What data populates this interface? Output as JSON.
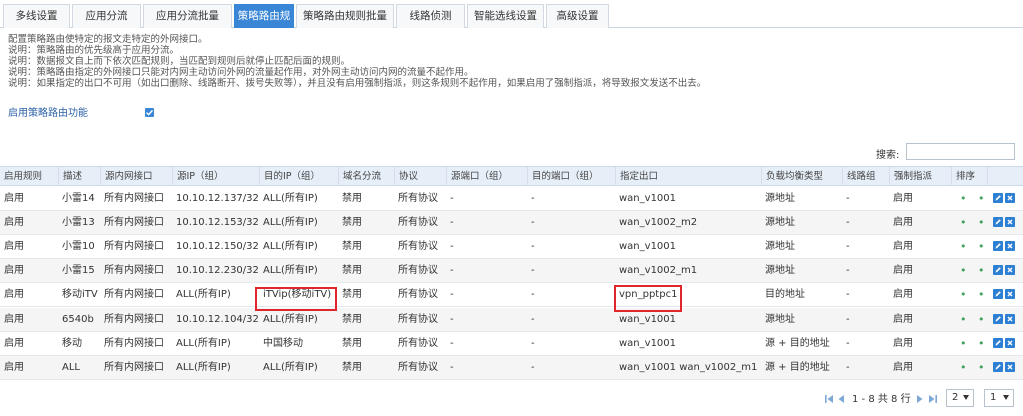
{
  "tabs": [
    {
      "label": "多线设置",
      "active": false
    },
    {
      "label": "应用分流",
      "active": false
    },
    {
      "label": "应用分流批量",
      "active": false
    },
    {
      "label": "策略路由规则",
      "active": true
    },
    {
      "label": "策略路由规则批量",
      "active": false
    },
    {
      "label": "线路侦测",
      "active": false
    },
    {
      "label": "智能选线设置",
      "active": false
    },
    {
      "label": "高级设置",
      "active": false
    }
  ],
  "description": [
    "配置策略路由使特定的报文走特定的外网接口。",
    "说明：策略路由的优先级高于应用分流。",
    "说明：数据报文自上而下依次匹配规则，当匹配到规则后就停止匹配后面的规则。",
    "说明：策略路由指定的外网接口只能对内网主动访问外网的流量起作用，对外网主动访问内网的流量不起作用。",
    "说明：如果指定的出口不可用（如出口删除、线路断开、拨号失败等），并且没有启用强制指派，则这条规则不起作用，如果启用了强制指派，将导致报文发送不出去。"
  ],
  "enable": {
    "label": "启用策略路由功能",
    "checked": true
  },
  "search": {
    "label": "搜索:",
    "value": ""
  },
  "columns": [
    "启用规则",
    "描述",
    "源内网接口",
    "源IP（组）",
    "目的IP（组）",
    "域名分流",
    "协议",
    "源端口（组）",
    "目的端口（组）",
    "指定出口",
    "负载均衡类型",
    "线路组",
    "强制指派",
    "排序"
  ],
  "rows": [
    [
      "启用",
      "小雷14",
      "所有内网接口",
      "10.10.12.137/32",
      "ALL(所有IP)",
      "禁用",
      "所有协议",
      "-",
      "-",
      "wan_v1001",
      "源地址",
      "-",
      "启用"
    ],
    [
      "启用",
      "小雷13",
      "所有内网接口",
      "10.10.12.153/32",
      "ALL(所有IP)",
      "禁用",
      "所有协议",
      "-",
      "-",
      "wan_v1002_m2",
      "源地址",
      "-",
      "启用"
    ],
    [
      "启用",
      "小雷10",
      "所有内网接口",
      "10.10.12.150/32",
      "ALL(所有IP)",
      "禁用",
      "所有协议",
      "-",
      "-",
      "wan_v1001",
      "源地址",
      "-",
      "启用"
    ],
    [
      "启用",
      "小雷15",
      "所有内网接口",
      "10.10.12.230/32",
      "ALL(所有IP)",
      "禁用",
      "所有协议",
      "-",
      "-",
      "wan_v1002_m1",
      "源地址",
      "-",
      "启用"
    ],
    [
      "启用",
      "移动iTV",
      "所有内网接口",
      "ALL(所有IP)",
      "iTVip(移动iTV)",
      "禁用",
      "所有协议",
      "-",
      "-",
      "vpn_pptpc1",
      "目的地址",
      "-",
      "启用"
    ],
    [
      "启用",
      "6540b",
      "所有内网接口",
      "10.10.12.104/32",
      "ALL(所有IP)",
      "禁用",
      "所有协议",
      "-",
      "-",
      "wan_v1001",
      "源地址",
      "-",
      "启用"
    ],
    [
      "启用",
      "移动",
      "所有内网接口",
      "ALL(所有IP)",
      "中国移动",
      "禁用",
      "所有协议",
      "-",
      "-",
      "wan_v1001",
      "源 + 目的地址",
      "-",
      "启用"
    ],
    [
      "启用",
      "ALL",
      "所有内网接口",
      "ALL(所有IP)",
      "ALL(所有IP)",
      "禁用",
      "所有协议",
      "-",
      "-",
      "wan_v1001 wan_v1002_m1",
      "源 + 目的地址",
      "-",
      "启用"
    ]
  ],
  "order_glyph": "• •",
  "pager": {
    "info": "1 - 8 共 8 行",
    "page": "2",
    "page_size": "1"
  },
  "colors": {
    "accent": "#3a86d6",
    "highlight": "#e0262a",
    "order": "#3fa25b"
  }
}
